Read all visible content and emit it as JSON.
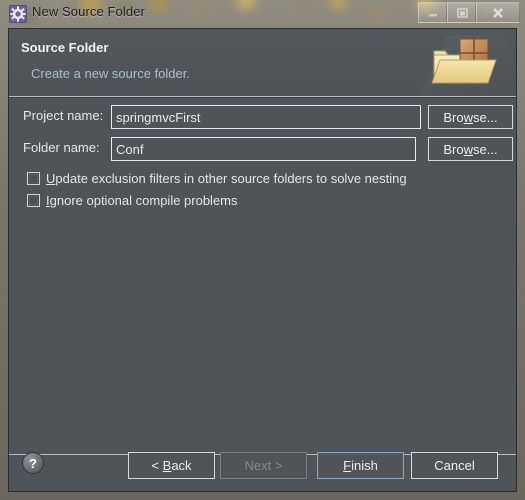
{
  "window": {
    "title": "New Source Folder",
    "icon": "wizard-gear-icon",
    "controls": {
      "minimize": "minimize-icon",
      "maximize": "maximize-icon",
      "close": "close-icon"
    }
  },
  "header": {
    "title": "Source Folder",
    "subtitle": "Create a new source folder.",
    "icon": "source-folder-package-icon"
  },
  "form": {
    "project": {
      "label": "Project name:",
      "value": "springmvcFirst",
      "placeholder": "",
      "browse_label": "Browse...",
      "browse_mnemonic": "w"
    },
    "folder": {
      "label": "Folder name:",
      "value": "Conf",
      "placeholder": "",
      "browse_label": "Browse...",
      "browse_mnemonic": "w"
    },
    "checkboxes": [
      {
        "label": "Update exclusion filters in other source folders to solve nesting",
        "mnemonic": "U",
        "checked": false
      },
      {
        "label": "Ignore optional compile problems",
        "mnemonic": "I",
        "checked": false
      }
    ]
  },
  "buttons": {
    "help": "?",
    "back": "< Back",
    "back_mnemonic": "B",
    "next": "Next >",
    "next_enabled": false,
    "finish": "Finish",
    "finish_mnemonic": "F",
    "finish_default": true,
    "cancel": "Cancel"
  },
  "colors": {
    "dialog_background": "#4e5457",
    "header_background": "#515759",
    "text_primary": "#e6e6e6",
    "text_subtitle": "#a8bfcc",
    "default_button_border": "#7ea7c4",
    "disabled_text": "#848a8d",
    "frame_glass": "#8d8878"
  }
}
